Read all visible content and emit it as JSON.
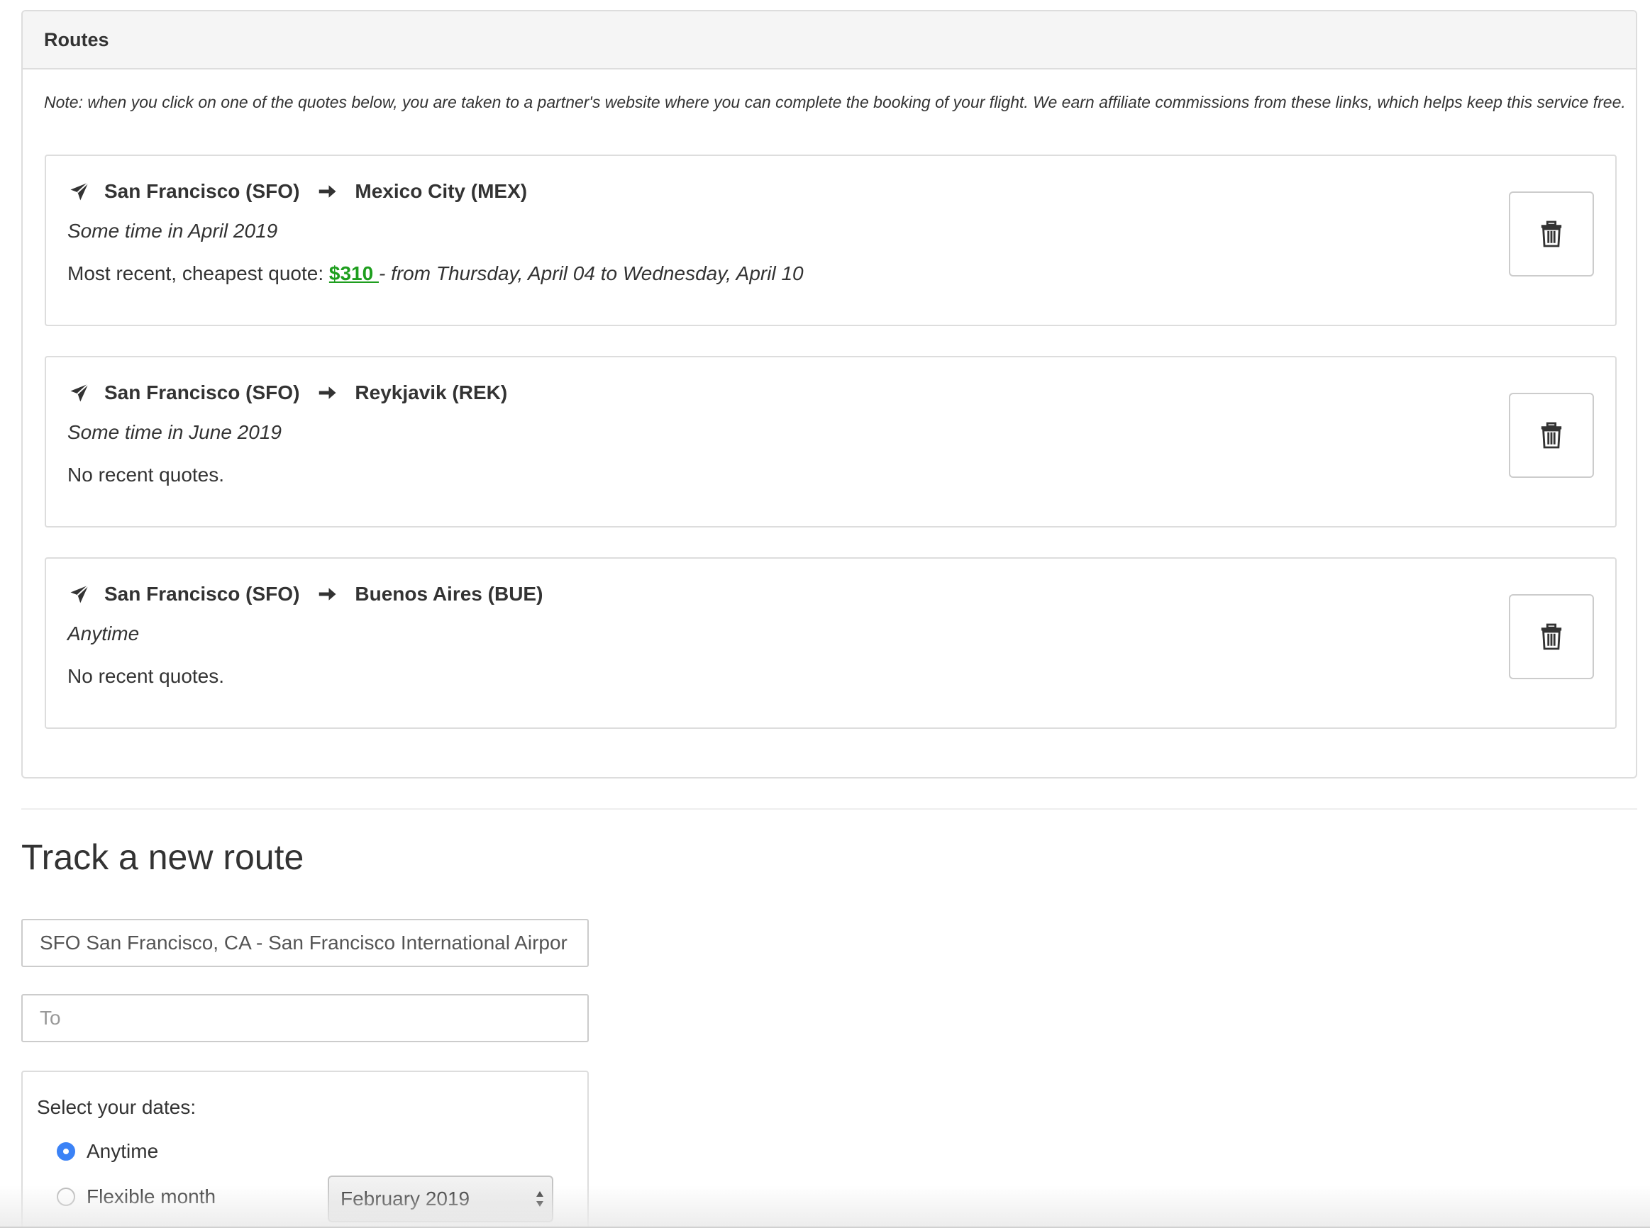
{
  "routes_panel": {
    "title": "Routes",
    "note": "Note: when you click on one of the quotes below, you are taken to a partner's website where you can complete the booking of your flight. We earn affiliate commissions from these links, which helps keep this service free.",
    "routes": [
      {
        "origin": "San Francisco (SFO)",
        "destination": "Mexico City (MEX)",
        "dates": "Some time in April 2019",
        "quote_prefix": "Most recent, cheapest quote: ",
        "quote_price": "$310 ",
        "quote_range": "- from Thursday, April 04 to Wednesday, April 10"
      },
      {
        "origin": "San Francisco (SFO)",
        "destination": "Reykjavik (REK)",
        "dates": "Some time in June 2019",
        "quote_text": "No recent quotes."
      },
      {
        "origin": "San Francisco (SFO)",
        "destination": "Buenos Aires (BUE)",
        "dates": "Anytime",
        "quote_text": "No recent quotes."
      }
    ]
  },
  "track_form": {
    "title": "Track a new route",
    "from_value": "SFO San Francisco, CA - San Francisco International Airpor",
    "to_placeholder": "To",
    "dates_label": "Select your dates:",
    "option_anytime": "Anytime",
    "option_flexible": "Flexible month",
    "selected_option": "Anytime",
    "month_value": "February 2019"
  },
  "icons": {
    "plane": "paper-plane-icon",
    "arrow": "arrow-right-icon",
    "delete": "trash-icon"
  },
  "colors": {
    "price": "#1e9e1e",
    "radio_selected": "#3b82f6",
    "panel_heading_bg": "#f5f5f5",
    "border": "#dddddd"
  }
}
